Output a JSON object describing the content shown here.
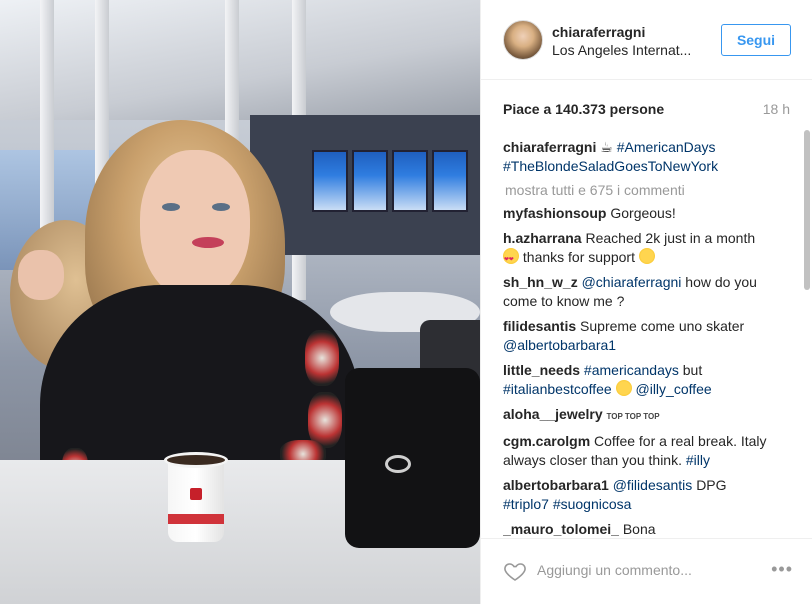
{
  "header": {
    "username": "chiaraferragni",
    "location": "Los Angeles Internat...",
    "follow_label": "Segui"
  },
  "stats": {
    "likes": "Piace a 140.373 persone",
    "time": "18 h"
  },
  "caption": {
    "user": "chiaraferragni",
    "emoji": "☕",
    "tag1": "#AmericanDays",
    "tag2": "#TheBlondeSaladGoesToNewYork"
  },
  "show_all": "mostra tutti e 675 i commenti",
  "comments": [
    {
      "user": "myfashionsoup",
      "text": "Gorgeous!"
    },
    {
      "user": "h.azharrana",
      "text": "Reached 2k just in a month",
      "text2": "thanks for support"
    },
    {
      "user": "sh_hn_w_z",
      "mention": "@chiaraferragni",
      "text": "how do you come to know me ?"
    },
    {
      "user": "filidesantis",
      "text": "Supreme come uno skater",
      "mention": "@albertobarbara1"
    },
    {
      "user": "little_needs",
      "tag1": "#americandays",
      "text": "but",
      "tag2": "#italianbestcoffee",
      "mention": "@illy_coffee"
    },
    {
      "user": "aloha__jewelry",
      "icons": "TOP TOP TOP"
    },
    {
      "user": "cgm.carolgm",
      "text": "Coffee for a real break. Italy always closer than you think.",
      "tag": "#illy"
    },
    {
      "user": "albertobarbara1",
      "mention": "@filidesantis",
      "text": "DPG",
      "tag1": "#triplo7",
      "tag2": "#suognicosa"
    },
    {
      "user": "_mauro_tolomei_",
      "text": "Bona"
    }
  ],
  "footer": {
    "placeholder": "Aggiungi un commento...",
    "more": "•••"
  }
}
